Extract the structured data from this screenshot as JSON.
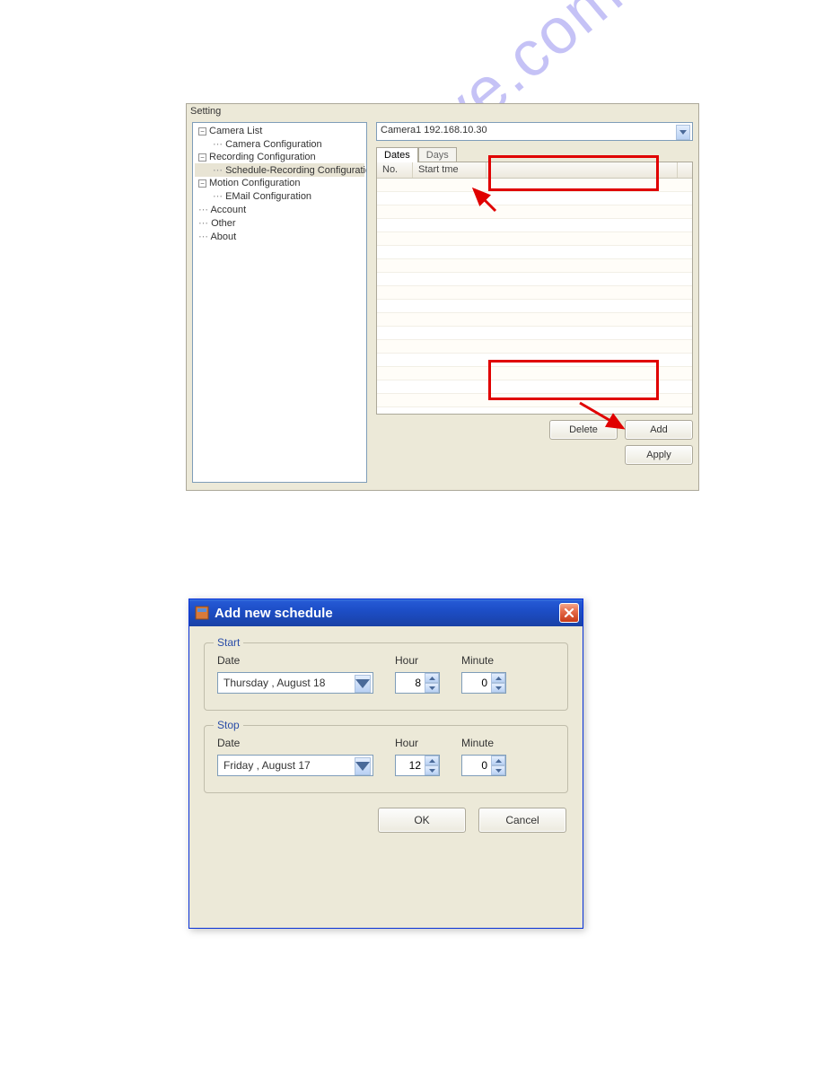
{
  "settings": {
    "title": "Setting",
    "tree": {
      "camera_list": "Camera List",
      "camera_config": "Camera Configuration",
      "recording_config": "Recording Configuration",
      "schedule_recording": "Schedule-Recording Configuration",
      "motion_config": "Motion Configuration",
      "email_config": "EMail Configuration",
      "account": "Account",
      "other": "Other",
      "about": "About"
    },
    "camera_selected": "Camera1 192.168.10.30",
    "tabs": {
      "dates": "Dates",
      "days": "Days"
    },
    "columns": {
      "no": "No.",
      "start": "Start tme"
    },
    "buttons": {
      "delete": "Delete",
      "add": "Add",
      "apply": "Apply"
    }
  },
  "dialog": {
    "title": "Add new schedule",
    "start": {
      "legend": "Start",
      "date_label": "Date",
      "date_value": "Thursday ,   August   18",
      "hour_label": "Hour",
      "hour_value": "8",
      "minute_label": "Minute",
      "minute_value": "0"
    },
    "stop": {
      "legend": "Stop",
      "date_label": "Date",
      "date_value": "Friday    ,   August   17",
      "hour_label": "Hour",
      "hour_value": "12",
      "minute_label": "Minute",
      "minute_value": "0"
    },
    "buttons": {
      "ok": "OK",
      "cancel": "Cancel"
    }
  },
  "watermark": "manualshive.com"
}
